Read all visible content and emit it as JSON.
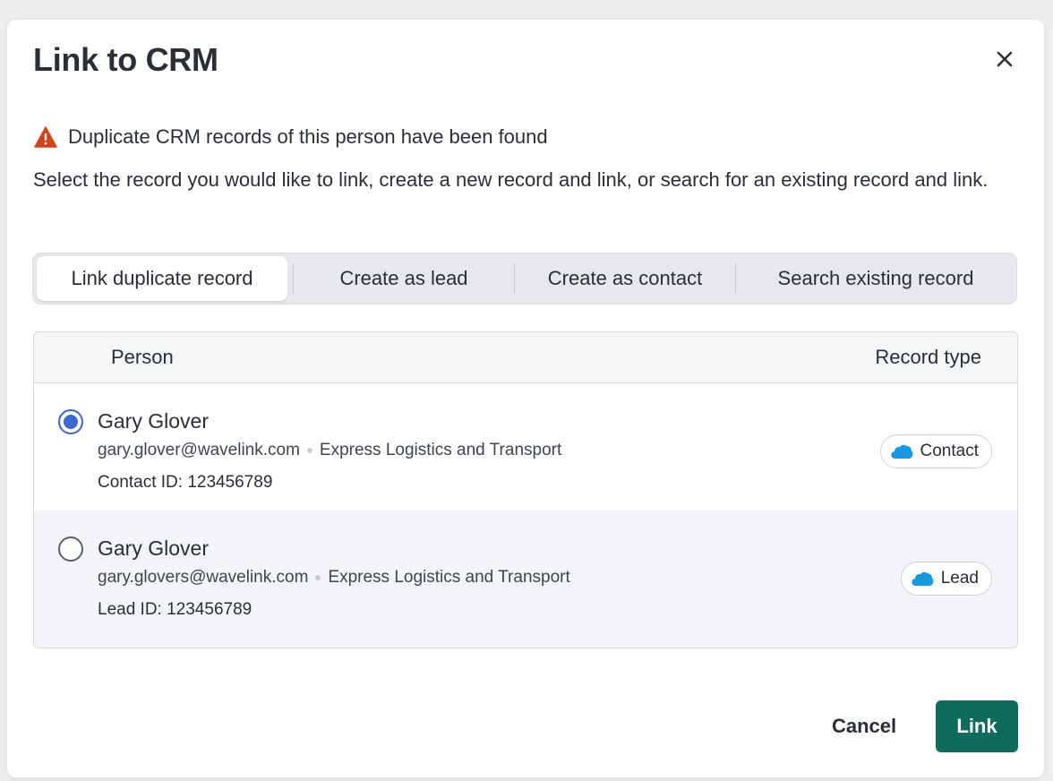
{
  "dialog": {
    "title": "Link to CRM",
    "close_icon": "close-icon"
  },
  "warning": {
    "icon": "warning-triangle-icon",
    "icon_color": "#d4441c",
    "text": "Duplicate CRM records of this person have been found"
  },
  "description": "Select the record you would like to link, create a new record and link, or search for an existing record and link.",
  "tabs": [
    {
      "label": "Link duplicate record",
      "active": true
    },
    {
      "label": "Create as lead",
      "active": false
    },
    {
      "label": "Create as contact",
      "active": false
    },
    {
      "label": "Search existing record",
      "active": false
    }
  ],
  "table": {
    "headers": {
      "person": "Person",
      "record_type": "Record type"
    },
    "rows": [
      {
        "selected": true,
        "name": "Gary Glover",
        "email": "gary.glover@wavelink.com",
        "company": "Express Logistics and Transport",
        "id_text": "Contact ID: 123456789",
        "record_type": "Contact",
        "record_icon": "salesforce-cloud-icon"
      },
      {
        "selected": false,
        "name": "Gary Glover",
        "email": "gary.glovers@wavelink.com",
        "company": "Express Logistics and Transport",
        "id_text": "Lead ID: 123456789",
        "record_type": "Lead",
        "record_icon": "salesforce-cloud-icon"
      }
    ]
  },
  "footer": {
    "cancel_label": "Cancel",
    "link_label": "Link"
  },
  "colors": {
    "primary_button": "#0f6b5c",
    "radio_selected": "#3f67d1",
    "cloud_icon": "#1798e0"
  }
}
